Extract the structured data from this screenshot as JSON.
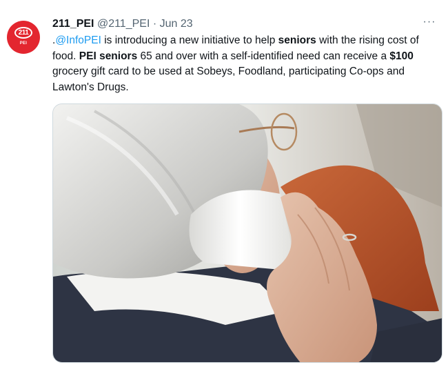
{
  "tweet": {
    "display_name": "211_PEI",
    "handle": "@211_PEI",
    "separator": "·",
    "date": "Jun 23",
    "more_label": "···",
    "avatar": {
      "logo_text": "211",
      "logo_sub": "PEI",
      "color": "#e3262f"
    },
    "text": {
      "prefix": ".",
      "mention": "@InfoPEI",
      "part1": " is introducing a new initiative to help ",
      "bold1": "seniors",
      "part2": " with the rising cost of food. ",
      "bold2": "PEI seniors",
      "part3": " 65 and over with a self-identified need can receive a ",
      "bold3": "$100",
      "part4": " grocery gift card to be used at Sobeys, Foodland, participating Co-ops and Lawton's Drugs."
    },
    "media": {
      "icon": "photo"
    }
  },
  "colors": {
    "text": "#0f1419",
    "secondary": "#536471",
    "link": "#1d9bf0",
    "border": "#cfd9de"
  }
}
